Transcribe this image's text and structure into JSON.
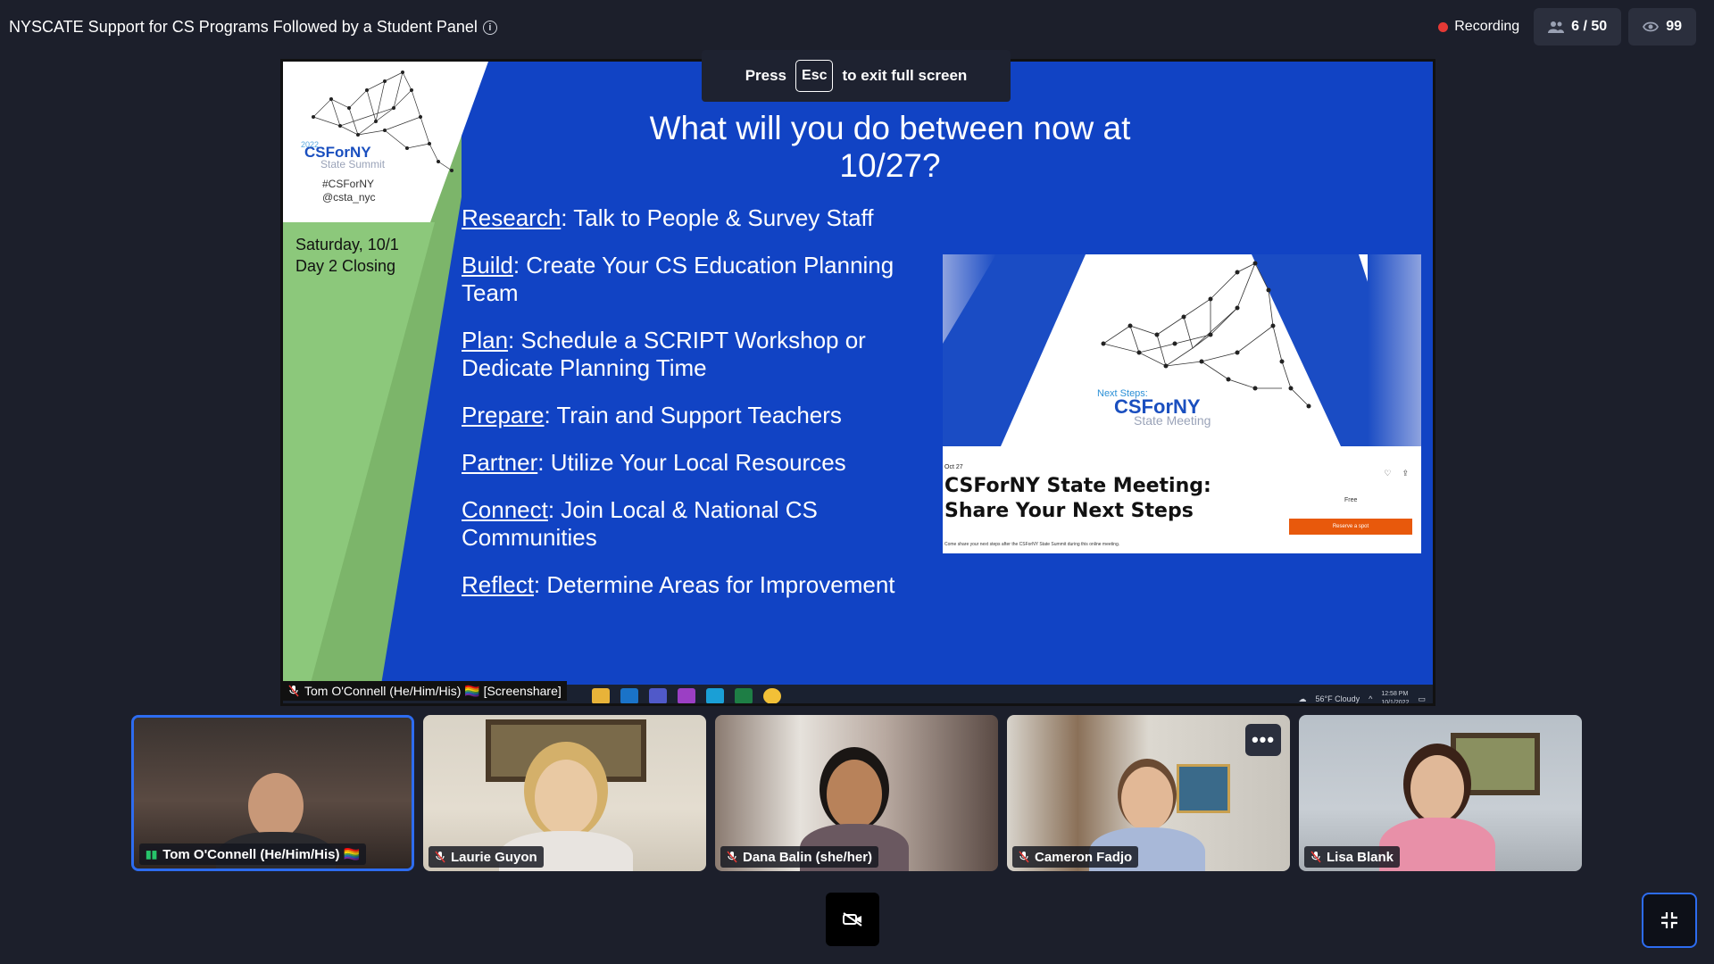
{
  "meeting": {
    "title": "NYSCATE Support for CS Programs Followed by a Student Panel",
    "recording_label": "Recording",
    "participants_count": "6 / 50",
    "viewers_count": "99"
  },
  "fullscreen_banner": {
    "press": "Press",
    "key": "Esc",
    "suffix": "to exit full screen"
  },
  "slide": {
    "logo_year": "2022",
    "logo_text": "CSForNY",
    "logo_sub": "State Summit",
    "hashtag": "#CSForNY",
    "handle": "@csta_nyc",
    "date_line1": "Saturday, 10/1",
    "date_line2": "Day 2 Closing",
    "title": "What will you do between now at 10/27?",
    "items": [
      {
        "term": "Research",
        "text": ": Talk to People & Survey Staff"
      },
      {
        "term": "Build",
        "text": ": Create Your CS Education Planning Team"
      },
      {
        "term": "Plan",
        "text": ": Schedule a SCRIPT Workshop or Dedicate Planning Time"
      },
      {
        "term": "Prepare",
        "text": ": Train and Support Teachers"
      },
      {
        "term": "Partner",
        "text": ": Utilize Your Local Resources"
      },
      {
        "term": "Connect",
        "text": ": Join Local & National CS Communities"
      },
      {
        "term": "Reflect",
        "text": ": Determine Areas for Improvement"
      }
    ],
    "promo": {
      "next_steps": "Next Steps:",
      "logo": "CSForNY",
      "logo_sub": "State Meeting",
      "date": "Oct 27",
      "heading_line1": "CSForNY State Meeting:",
      "heading_line2": "Share Your Next Steps",
      "price": "Free",
      "button": "Reserve a spot",
      "footer": "Come share your next steps after the CSForNY State Summit during this online meeting."
    }
  },
  "share_label": "Tom O'Connell (He/Him/His) 🏳️‍🌈 [Screenshare]",
  "taskbar": {
    "weather": "56°F Cloudy",
    "time": "12:58 PM",
    "date": "10/1/2022"
  },
  "participants": [
    {
      "name": "Tom O'Connell (He/Him/His) 🏳️‍🌈",
      "speaking": true
    },
    {
      "name": "Laurie Guyon",
      "speaking": false
    },
    {
      "name": "Dana Balin (she/her)",
      "speaking": false
    },
    {
      "name": "Cameron Fadjo",
      "speaking": false
    },
    {
      "name": "Lisa Blank",
      "speaking": false
    }
  ],
  "more_label": "•••",
  "colors": {
    "accent": "#2d6cf0",
    "record": "#e53935",
    "slide_blue": "#1143c4",
    "slide_green": "#7cb56a"
  }
}
